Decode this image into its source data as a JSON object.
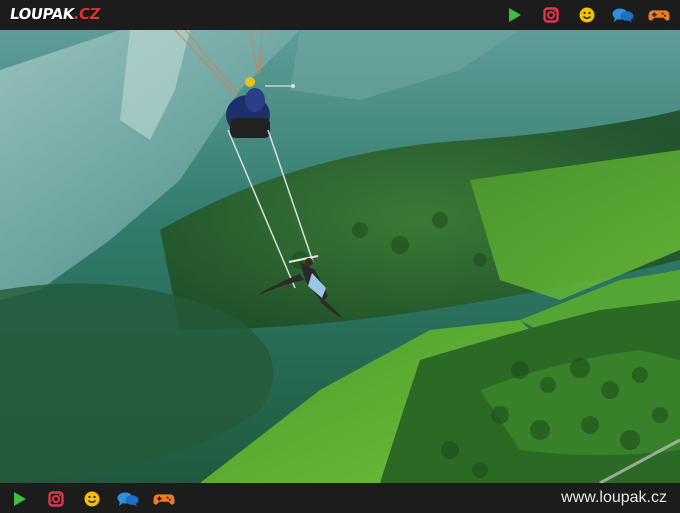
{
  "header": {
    "logo": {
      "main": "LOUPAK",
      "tld": ".CZ"
    },
    "icons": [
      "play-icon",
      "instagram-icon",
      "smiley-icon",
      "chat-icon",
      "gamepad-icon"
    ]
  },
  "photo": {
    "subject": "tandem paraglider with a woman hanging below on a trapeze swing above a green valley"
  },
  "footer": {
    "icons": [
      "play-icon",
      "instagram-icon",
      "smiley-icon",
      "chat-icon",
      "gamepad-icon"
    ],
    "site_url": "www.loupak.cz"
  },
  "colors": {
    "bar_bg": "#1c1c1c",
    "logo_accent": "#e5322d",
    "play": "#3fbf3f",
    "instagram": "#e0344f",
    "smiley": "#f2c200",
    "chat": "#2f8fe0",
    "gamepad": "#f07a1f"
  }
}
